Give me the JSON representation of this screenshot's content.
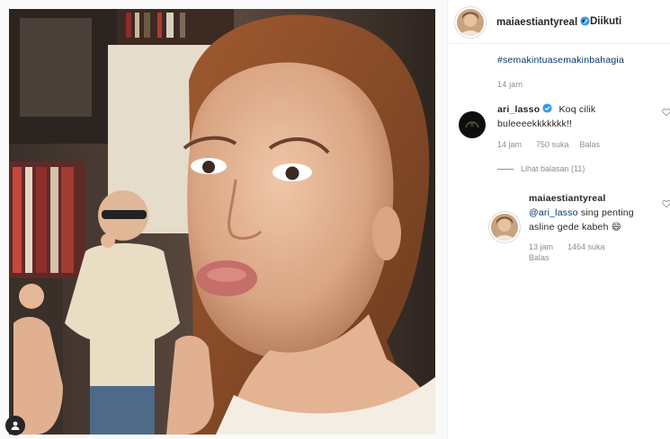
{
  "post": {
    "username": "maiaestiantyreal",
    "verified": true,
    "separator": "•",
    "follow_status": "Diikuti",
    "caption_hashtag": "#semakintuasemakinbahagia",
    "caption_time": "14 jam"
  },
  "comments": [
    {
      "username": "ari_lasso",
      "verified": true,
      "text_line1": "Koq cilik",
      "text_line2": "buleeeekkkkkkk!!",
      "time": "14 jam",
      "likes": "750 suka",
      "reply_label": "Balas",
      "view_replies": "Lihat balasan (11)"
    },
    {
      "username": "maiaestiantyreal",
      "mention": "@ari_lasso",
      "text_line1_rest": "sing penting",
      "text_line2": "asline gede kabeh 😄",
      "time": "13 jam",
      "likes": "1464 suka",
      "reply_label": "Balas"
    }
  ],
  "icons": {
    "verified": "verified-badge-icon",
    "heart": "heart-icon",
    "user_tag": "user-tag-icon"
  },
  "colors": {
    "verified_blue": "#3897f0",
    "link_blue": "#00376b",
    "muted": "#8e8e8e"
  }
}
